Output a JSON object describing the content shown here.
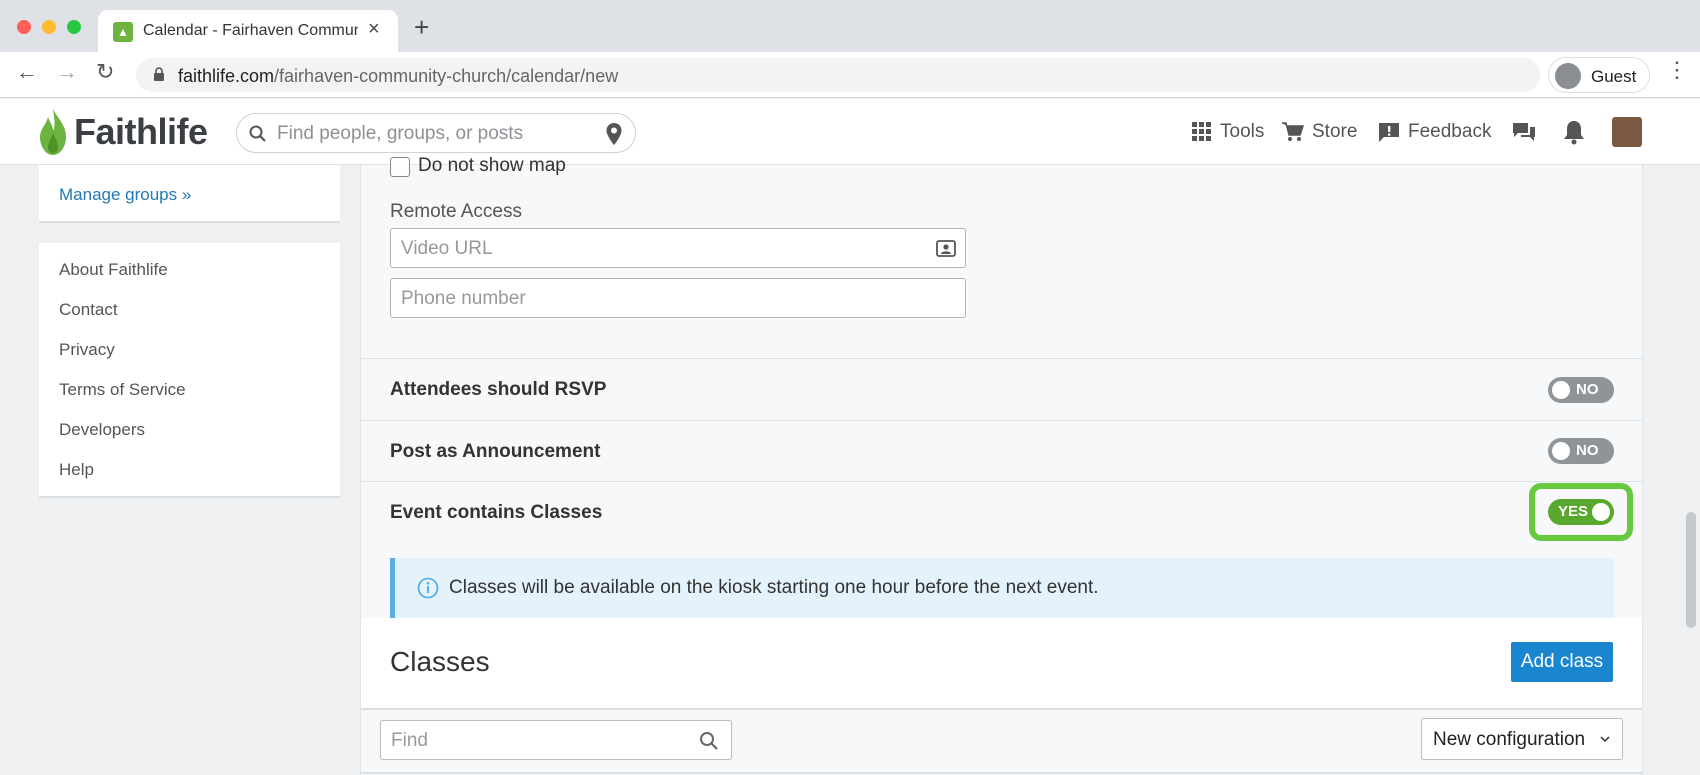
{
  "browser": {
    "tab_title": "Calendar - Fairhaven Community Church",
    "url_host": "faithlife.com",
    "url_path": "/fairhaven-community-church/calendar/new",
    "profile_label": "Guest"
  },
  "header": {
    "logo_text": "Faithlife",
    "search_placeholder": "Find people, groups, or posts",
    "tools_label": "Tools",
    "store_label": "Store",
    "feedback_label": "Feedback"
  },
  "sidebar": {
    "manage_groups": "Manage groups »",
    "links": [
      "About Faithlife",
      "Contact",
      "Privacy",
      "Terms of Service",
      "Developers",
      "Help"
    ]
  },
  "form": {
    "do_not_show_map": "Do not show map",
    "remote_access_label": "Remote Access",
    "video_url_placeholder": "Video URL",
    "phone_placeholder": "Phone number",
    "rsvp": {
      "label": "Attendees should RSVP",
      "state": "NO"
    },
    "announcement": {
      "label": "Post as Announcement",
      "state": "NO"
    },
    "classes_toggle": {
      "label": "Event contains Classes",
      "state": "YES"
    },
    "info_text": "Classes will be available on the kiosk starting one hour before the next event."
  },
  "classes": {
    "title": "Classes",
    "add_button": "Add class",
    "find_placeholder": "Find",
    "config_selected": "New configuration"
  },
  "colors": {
    "brand_green": "#6cb33f",
    "toggle_on": "#5aa72d",
    "toggle_off": "#8f9499",
    "highlight": "#67c93e",
    "primary_button": "#1a86d0",
    "link": "#2379b6"
  }
}
